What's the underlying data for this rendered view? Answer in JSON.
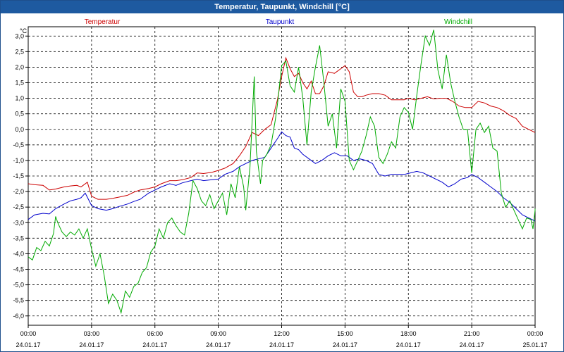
{
  "window": {
    "title": "Temperatur, Taupunkt, Windchill [°C]"
  },
  "chart_data": {
    "type": "line",
    "title": "Temperatur, Taupunkt, Windchill [°C]",
    "ylabel": "°C",
    "ylim": [
      -6.3,
      3.3
    ],
    "y_ticks": [
      3.0,
      2.5,
      2.0,
      1.5,
      1.0,
      0.5,
      0.0,
      -0.5,
      -1.0,
      -1.5,
      -2.0,
      -2.5,
      -3.0,
      -3.5,
      -4.0,
      -4.5,
      -5.0,
      -5.5,
      -6.0
    ],
    "y_tick_labels": [
      "3,0",
      "2,5",
      "2,0",
      "1,5",
      "1,0",
      "0,5",
      "0,0",
      "-0,5",
      "-1,0",
      "-1,5",
      "-2,0",
      "-2,5",
      "-3,0",
      "-3,5",
      "-4,0",
      "-4,5",
      "-5,0",
      "-5,5",
      "-6,0"
    ],
    "xlim": [
      0,
      24
    ],
    "x_ticks": [
      {
        "h": 0,
        "time": "00:00",
        "date": "24.01.17"
      },
      {
        "h": 3,
        "time": "03:00",
        "date": "24.01.17"
      },
      {
        "h": 6,
        "time": "06:00",
        "date": "24.01.17"
      },
      {
        "h": 9,
        "time": "09:00",
        "date": "24.01.17"
      },
      {
        "h": 12,
        "time": "12:00",
        "date": "24.01.17"
      },
      {
        "h": 15,
        "time": "15:00",
        "date": "24.01.17"
      },
      {
        "h": 18,
        "time": "18:00",
        "date": "24.01.17"
      },
      {
        "h": 21,
        "time": "21:00",
        "date": "24.01.17"
      },
      {
        "h": 24,
        "time": "00:00",
        "date": "25.01.17"
      }
    ],
    "grid": true,
    "legend_position": "top",
    "series": [
      {
        "name": "Temperatur",
        "color": "#cc0000",
        "points": [
          [
            0,
            -1.75
          ],
          [
            0.3,
            -1.78
          ],
          [
            0.7,
            -1.8
          ],
          [
            1.0,
            -1.95
          ],
          [
            1.3,
            -1.92
          ],
          [
            1.7,
            -1.85
          ],
          [
            2.0,
            -1.82
          ],
          [
            2.3,
            -1.8
          ],
          [
            2.5,
            -1.85
          ],
          [
            2.8,
            -1.7
          ],
          [
            3.0,
            -2.15
          ],
          [
            3.3,
            -2.25
          ],
          [
            3.7,
            -2.25
          ],
          [
            4.0,
            -2.22
          ],
          [
            4.3,
            -2.18
          ],
          [
            4.7,
            -2.12
          ],
          [
            5.0,
            -2.02
          ],
          [
            5.3,
            -1.95
          ],
          [
            5.7,
            -1.9
          ],
          [
            6.0,
            -1.85
          ],
          [
            6.3,
            -1.75
          ],
          [
            6.7,
            -1.65
          ],
          [
            7.0,
            -1.65
          ],
          [
            7.3,
            -1.62
          ],
          [
            7.7,
            -1.55
          ],
          [
            8.0,
            -1.4
          ],
          [
            8.3,
            -1.42
          ],
          [
            8.7,
            -1.38
          ],
          [
            9.0,
            -1.32
          ],
          [
            9.3,
            -1.25
          ],
          [
            9.7,
            -1.1
          ],
          [
            10.0,
            -0.85
          ],
          [
            10.3,
            -0.55
          ],
          [
            10.6,
            -0.1
          ],
          [
            10.9,
            -0.2
          ],
          [
            11.2,
            0.0
          ],
          [
            11.5,
            0.15
          ],
          [
            11.8,
            0.95
          ],
          [
            12.0,
            1.7
          ],
          [
            12.2,
            2.3
          ],
          [
            12.4,
            1.95
          ],
          [
            12.6,
            1.7
          ],
          [
            12.8,
            1.8
          ],
          [
            13.0,
            1.5
          ],
          [
            13.2,
            1.3
          ],
          [
            13.4,
            1.55
          ],
          [
            13.6,
            1.15
          ],
          [
            13.8,
            1.15
          ],
          [
            14.0,
            1.4
          ],
          [
            14.2,
            1.85
          ],
          [
            14.5,
            1.8
          ],
          [
            14.8,
            1.95
          ],
          [
            15.0,
            2.05
          ],
          [
            15.2,
            1.85
          ],
          [
            15.4,
            1.2
          ],
          [
            15.6,
            1.05
          ],
          [
            15.8,
            1.05
          ],
          [
            16.0,
            1.1
          ],
          [
            16.3,
            1.15
          ],
          [
            16.6,
            1.15
          ],
          [
            16.9,
            1.1
          ],
          [
            17.2,
            0.95
          ],
          [
            17.5,
            0.95
          ],
          [
            17.8,
            0.95
          ],
          [
            18.0,
            1.0
          ],
          [
            18.3,
            0.95
          ],
          [
            18.6,
            1.0
          ],
          [
            18.9,
            1.05
          ],
          [
            19.2,
            0.98
          ],
          [
            19.5,
            1.0
          ],
          [
            19.8,
            1.0
          ],
          [
            20.1,
            0.9
          ],
          [
            20.4,
            0.75
          ],
          [
            20.7,
            0.7
          ],
          [
            21.0,
            0.7
          ],
          [
            21.3,
            0.9
          ],
          [
            21.6,
            0.85
          ],
          [
            21.9,
            0.75
          ],
          [
            22.2,
            0.7
          ],
          [
            22.5,
            0.6
          ],
          [
            22.8,
            0.45
          ],
          [
            23.1,
            0.35
          ],
          [
            23.4,
            0.1
          ],
          [
            23.7,
            0.0
          ],
          [
            24.0,
            -0.1
          ]
        ]
      },
      {
        "name": "Taupunkt",
        "color": "#0000cc",
        "points": [
          [
            0,
            -2.9
          ],
          [
            0.3,
            -2.75
          ],
          [
            0.7,
            -2.7
          ],
          [
            1.0,
            -2.72
          ],
          [
            1.3,
            -2.55
          ],
          [
            1.7,
            -2.4
          ],
          [
            2.0,
            -2.3
          ],
          [
            2.3,
            -2.25
          ],
          [
            2.5,
            -2.2
          ],
          [
            2.7,
            -2.05
          ],
          [
            3.0,
            -2.45
          ],
          [
            3.3,
            -2.55
          ],
          [
            3.7,
            -2.6
          ],
          [
            4.0,
            -2.55
          ],
          [
            4.3,
            -2.48
          ],
          [
            4.7,
            -2.4
          ],
          [
            5.0,
            -2.32
          ],
          [
            5.3,
            -2.25
          ],
          [
            5.7,
            -2.05
          ],
          [
            6.0,
            -1.95
          ],
          [
            6.3,
            -1.85
          ],
          [
            6.7,
            -1.75
          ],
          [
            7.0,
            -1.8
          ],
          [
            7.3,
            -1.72
          ],
          [
            7.7,
            -1.65
          ],
          [
            8.0,
            -1.6
          ],
          [
            8.3,
            -1.65
          ],
          [
            8.7,
            -1.62
          ],
          [
            9.0,
            -1.6
          ],
          [
            9.3,
            -1.45
          ],
          [
            9.7,
            -1.35
          ],
          [
            10.0,
            -1.2
          ],
          [
            10.3,
            -1.1
          ],
          [
            10.6,
            -1.0
          ],
          [
            10.9,
            -0.95
          ],
          [
            11.2,
            -0.9
          ],
          [
            11.5,
            -0.6
          ],
          [
            11.8,
            -0.3
          ],
          [
            12.0,
            -0.08
          ],
          [
            12.2,
            -0.2
          ],
          [
            12.4,
            -0.25
          ],
          [
            12.6,
            -0.6
          ],
          [
            12.8,
            -0.65
          ],
          [
            13.0,
            -0.8
          ],
          [
            13.3,
            -0.95
          ],
          [
            13.6,
            -1.1
          ],
          [
            13.9,
            -1.0
          ],
          [
            14.2,
            -0.85
          ],
          [
            14.5,
            -0.75
          ],
          [
            14.8,
            -0.85
          ],
          [
            15.1,
            -0.85
          ],
          [
            15.4,
            -1.0
          ],
          [
            15.7,
            -0.95
          ],
          [
            16.0,
            -1.0
          ],
          [
            16.3,
            -1.1
          ],
          [
            16.6,
            -1.45
          ],
          [
            16.9,
            -1.5
          ],
          [
            17.2,
            -1.45
          ],
          [
            17.5,
            -1.45
          ],
          [
            17.8,
            -1.45
          ],
          [
            18.1,
            -1.4
          ],
          [
            18.4,
            -1.35
          ],
          [
            18.7,
            -1.4
          ],
          [
            19.0,
            -1.5
          ],
          [
            19.3,
            -1.6
          ],
          [
            19.6,
            -1.7
          ],
          [
            19.9,
            -1.85
          ],
          [
            20.2,
            -1.75
          ],
          [
            20.5,
            -1.6
          ],
          [
            20.8,
            -1.55
          ],
          [
            21.0,
            -1.45
          ],
          [
            21.3,
            -1.55
          ],
          [
            21.6,
            -1.7
          ],
          [
            21.9,
            -1.85
          ],
          [
            22.2,
            -2.0
          ],
          [
            22.5,
            -2.2
          ],
          [
            22.8,
            -2.35
          ],
          [
            23.1,
            -2.55
          ],
          [
            23.4,
            -2.75
          ],
          [
            23.7,
            -2.85
          ],
          [
            24.0,
            -2.95
          ]
        ]
      },
      {
        "name": "Windchill",
        "color": "#00aa00",
        "points": [
          [
            0,
            -4.1
          ],
          [
            0.2,
            -4.2
          ],
          [
            0.4,
            -3.8
          ],
          [
            0.6,
            -3.9
          ],
          [
            0.8,
            -3.6
          ],
          [
            1.0,
            -3.75
          ],
          [
            1.2,
            -3.35
          ],
          [
            1.3,
            -2.8
          ],
          [
            1.4,
            -3.0
          ],
          [
            1.6,
            -3.3
          ],
          [
            1.8,
            -3.45
          ],
          [
            2.0,
            -3.3
          ],
          [
            2.2,
            -3.4
          ],
          [
            2.4,
            -3.2
          ],
          [
            2.6,
            -3.5
          ],
          [
            2.8,
            -3.2
          ],
          [
            3.0,
            -3.85
          ],
          [
            3.2,
            -4.4
          ],
          [
            3.4,
            -4.0
          ],
          [
            3.6,
            -4.7
          ],
          [
            3.8,
            -5.6
          ],
          [
            4.0,
            -5.3
          ],
          [
            4.2,
            -5.5
          ],
          [
            4.4,
            -5.9
          ],
          [
            4.6,
            -5.2
          ],
          [
            4.8,
            -5.4
          ],
          [
            5.0,
            -5.05
          ],
          [
            5.2,
            -4.95
          ],
          [
            5.4,
            -4.6
          ],
          [
            5.6,
            -4.45
          ],
          [
            5.8,
            -3.95
          ],
          [
            6.0,
            -3.75
          ],
          [
            6.2,
            -3.2
          ],
          [
            6.4,
            -3.5
          ],
          [
            6.6,
            -3.0
          ],
          [
            6.8,
            -2.85
          ],
          [
            7.0,
            -3.1
          ],
          [
            7.2,
            -3.3
          ],
          [
            7.4,
            -3.4
          ],
          [
            7.6,
            -2.7
          ],
          [
            7.8,
            -1.65
          ],
          [
            8.0,
            -1.9
          ],
          [
            8.2,
            -2.3
          ],
          [
            8.4,
            -2.45
          ],
          [
            8.6,
            -2.1
          ],
          [
            8.8,
            -2.55
          ],
          [
            9.0,
            -2.3
          ],
          [
            9.2,
            -2.05
          ],
          [
            9.4,
            -2.75
          ],
          [
            9.6,
            -1.75
          ],
          [
            9.8,
            -2.2
          ],
          [
            10.0,
            -1.2
          ],
          [
            10.2,
            -1.85
          ],
          [
            10.3,
            -2.6
          ],
          [
            10.5,
            -1.2
          ],
          [
            10.7,
            1.7
          ],
          [
            10.8,
            -0.7
          ],
          [
            11.0,
            -1.75
          ],
          [
            11.1,
            -1.0
          ],
          [
            11.3,
            -0.8
          ],
          [
            11.5,
            -0.5
          ],
          [
            11.7,
            0.3
          ],
          [
            11.8,
            0.8
          ],
          [
            12.0,
            2.05
          ],
          [
            12.2,
            2.2
          ],
          [
            12.4,
            1.4
          ],
          [
            12.6,
            1.2
          ],
          [
            12.8,
            2.0
          ],
          [
            13.0,
            1.0
          ],
          [
            13.2,
            -0.5
          ],
          [
            13.4,
            1.2
          ],
          [
            13.6,
            2.0
          ],
          [
            13.8,
            2.7
          ],
          [
            14.0,
            1.5
          ],
          [
            14.2,
            0.1
          ],
          [
            14.4,
            0.5
          ],
          [
            14.6,
            -0.6
          ],
          [
            14.8,
            1.3
          ],
          [
            15.0,
            0.9
          ],
          [
            15.2,
            -1.0
          ],
          [
            15.4,
            -1.3
          ],
          [
            15.6,
            -1.0
          ],
          [
            15.8,
            -0.7
          ],
          [
            16.0,
            -0.2
          ],
          [
            16.2,
            0.4
          ],
          [
            16.4,
            0.1
          ],
          [
            16.6,
            -0.9
          ],
          [
            16.8,
            -1.1
          ],
          [
            17.0,
            -0.8
          ],
          [
            17.2,
            -0.4
          ],
          [
            17.4,
            -0.6
          ],
          [
            17.6,
            0.4
          ],
          [
            17.8,
            0.7
          ],
          [
            18.0,
            0.55
          ],
          [
            18.2,
            0.0
          ],
          [
            18.4,
            1.1
          ],
          [
            18.6,
            2.1
          ],
          [
            18.8,
            3.0
          ],
          [
            19.0,
            2.7
          ],
          [
            19.2,
            3.2
          ],
          [
            19.4,
            1.9
          ],
          [
            19.6,
            1.3
          ],
          [
            19.8,
            2.4
          ],
          [
            20.0,
            1.5
          ],
          [
            20.2,
            0.9
          ],
          [
            20.4,
            0.4
          ],
          [
            20.6,
            0.0
          ],
          [
            20.8,
            0.0
          ],
          [
            21.0,
            -1.4
          ],
          [
            21.2,
            0.0
          ],
          [
            21.4,
            0.2
          ],
          [
            21.6,
            -0.1
          ],
          [
            21.8,
            0.1
          ],
          [
            22.0,
            -0.6
          ],
          [
            22.2,
            -0.7
          ],
          [
            22.4,
            -2.05
          ],
          [
            22.6,
            -2.5
          ],
          [
            22.8,
            -2.3
          ],
          [
            23.0,
            -2.6
          ],
          [
            23.2,
            -2.9
          ],
          [
            23.4,
            -3.2
          ],
          [
            23.6,
            -2.85
          ],
          [
            23.8,
            -2.9
          ],
          [
            23.9,
            -3.2
          ],
          [
            24.0,
            -2.6
          ],
          [
            24.0,
            -2.55
          ]
        ]
      }
    ]
  }
}
